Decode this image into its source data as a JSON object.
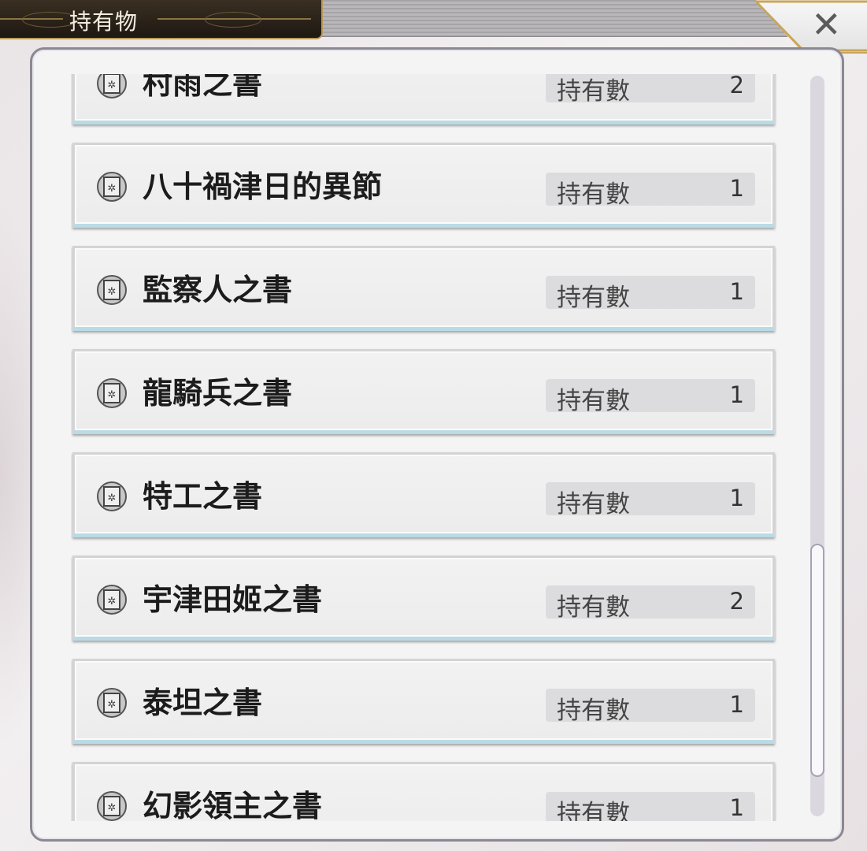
{
  "header": {
    "title": "持有物",
    "close_label": "✕"
  },
  "list": {
    "count_label": "持有數",
    "items": [
      {
        "name": "村雨之書",
        "count": "2"
      },
      {
        "name": "八十禍津日的異節",
        "count": "1"
      },
      {
        "name": "監察人之書",
        "count": "1"
      },
      {
        "name": "龍騎兵之書",
        "count": "1"
      },
      {
        "name": "特工之書",
        "count": "1"
      },
      {
        "name": "宇津田姬之書",
        "count": "2"
      },
      {
        "name": "泰坦之書",
        "count": "1"
      },
      {
        "name": "幻影領主之書",
        "count": "1"
      }
    ]
  },
  "scrollbar": {
    "position_fraction": 0.63
  },
  "icons": {
    "item_icon": "book-icon",
    "close_icon": "close-icon"
  }
}
